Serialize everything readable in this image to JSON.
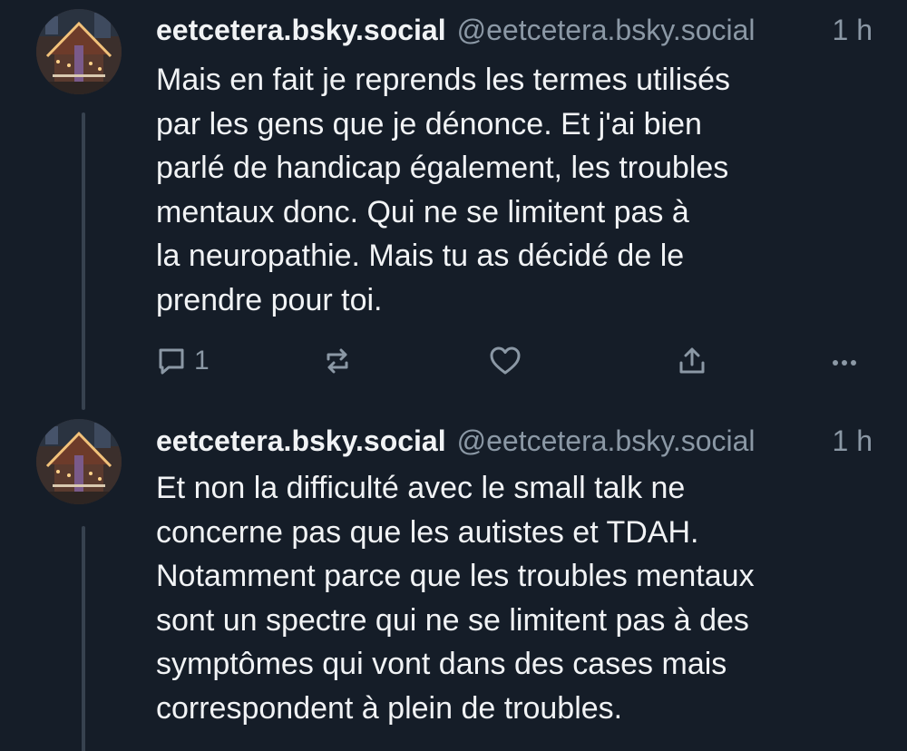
{
  "posts": [
    {
      "author": {
        "display_name": "eetcetera.bsky.social",
        "handle": "@eetcetera.bsky.social",
        "avatar_icon": "avatar-image"
      },
      "timestamp": "1 h",
      "text_lines": [
        "Mais en fait je reprends les termes utilisés",
        "par les gens que je dénonce. Et j'ai bien",
        "parlé de handicap également, les troubles",
        "mentaux donc. Qui ne se limitent pas à",
        "la neuropathie. Mais tu as décidé de le",
        "prendre pour toi."
      ],
      "actions": {
        "reply_icon": "comment-icon",
        "reply_count": "1",
        "repost_icon": "repost-icon",
        "like_icon": "heart-icon",
        "share_icon": "share-icon",
        "more_icon": "more-icon"
      }
    },
    {
      "author": {
        "display_name": "eetcetera.bsky.social",
        "handle": "@eetcetera.bsky.social",
        "avatar_icon": "avatar-image"
      },
      "timestamp": "1 h",
      "text_lines": [
        "Et non la difficulté avec le small talk ne",
        "concerne pas que les autistes et TDAH.",
        "Notamment parce que les troubles mentaux",
        "sont un spectre qui ne se limitent pas à des",
        "symptômes qui vont dans des cases mais",
        "correspondent à plein de troubles."
      ]
    }
  ],
  "colors": {
    "background": "#151d28",
    "text": "#f1f3f5",
    "muted": "#8b98a5",
    "thread_line": "#37424f"
  }
}
